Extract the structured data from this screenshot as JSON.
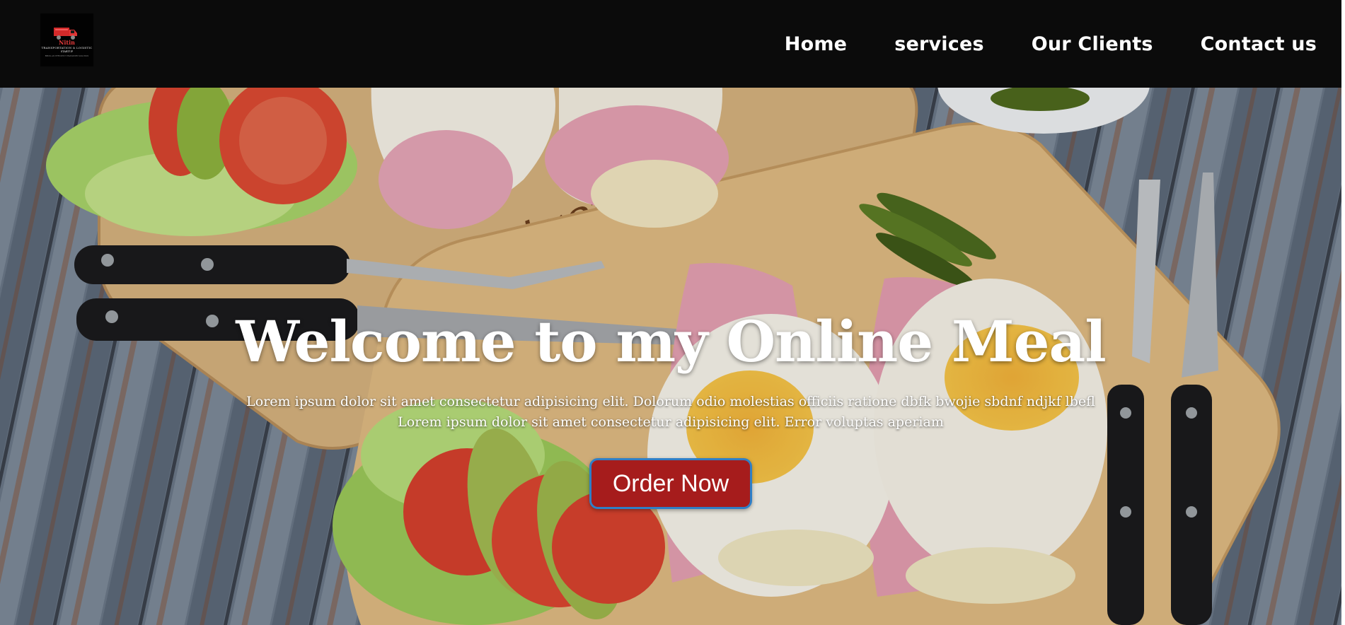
{
  "header": {
    "logo": {
      "name": "Nitin",
      "tagline": "TRANSPORTATION & LOGISTIC",
      "subtitle": "STARTUP",
      "fine_print": "BRING AN EFFICIENT TRANSPORT SOLUTION"
    },
    "nav": [
      "Home",
      "services",
      "Our Clients",
      "Contact us"
    ]
  },
  "hero": {
    "title": "Welcome to my Online Meal",
    "text_line1": "Lorem ipsum dolor sit amet consectetur adipisicing elit. Dolorum odio molestias officiis ratione dbfk bwojie sbdnf ndjkf lbefl",
    "text_line2": "Lorem ipsum dolor sit amet consectetur adipisicing elit. Error voluptas aperiam",
    "button_label": "Order Now"
  },
  "colors": {
    "navbar": "#0b0b0b",
    "button": "#a61c1c",
    "button_border": "#2f7fc7",
    "text": "#ffffff"
  },
  "icons": {
    "logo": "truck-logo-icon",
    "hero_background": "food-photo-image"
  }
}
